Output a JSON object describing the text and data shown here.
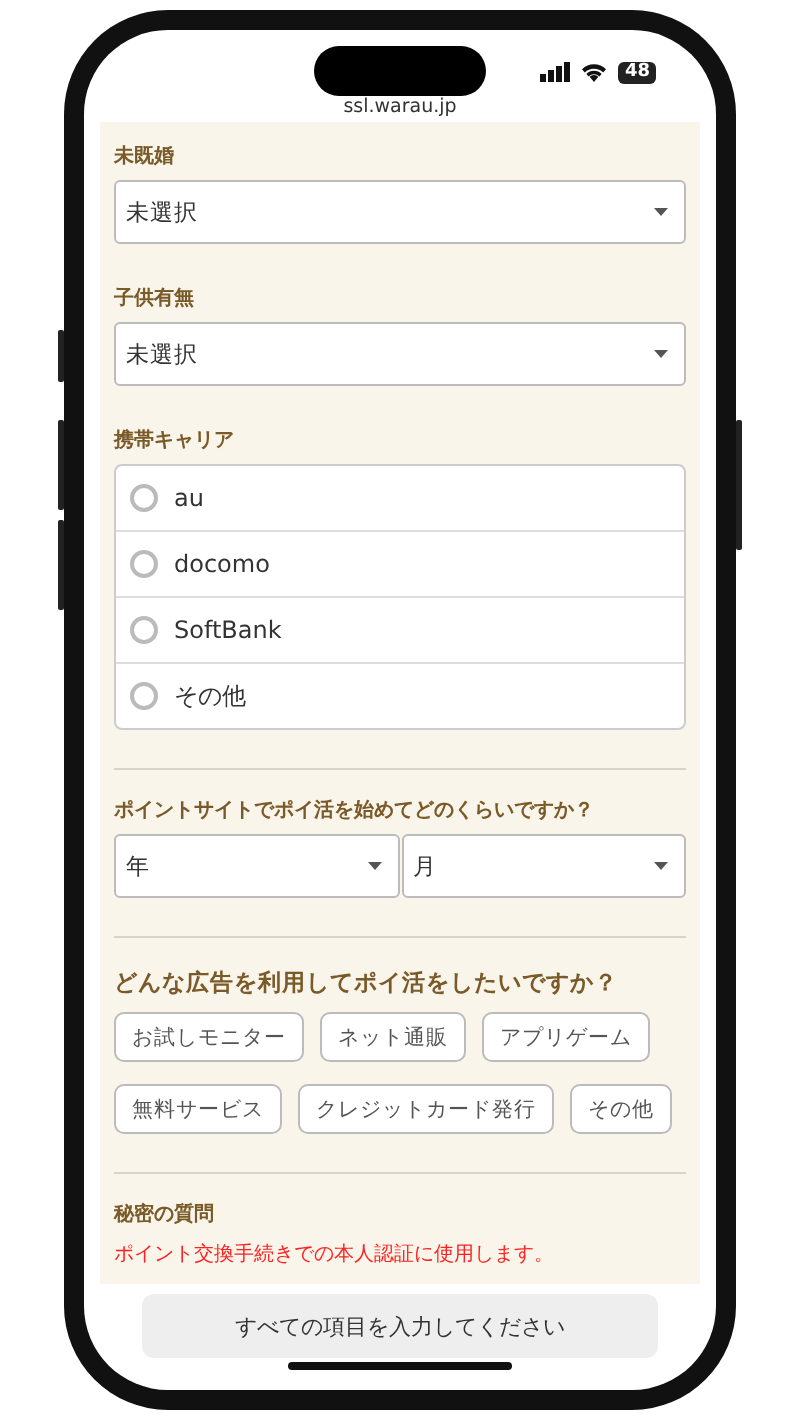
{
  "status_bar": {
    "battery": "48"
  },
  "address_bar": {
    "url": "ssl.warau.jp"
  },
  "fields": [
    {
      "label": "未既婚",
      "value": "未選択"
    },
    {
      "label": "子供有無",
      "value": "未選択"
    }
  ],
  "carrier": {
    "label": "携帯キャリア",
    "options": [
      {
        "label": "au",
        "selected": false
      },
      {
        "label": "docomo",
        "selected": false
      },
      {
        "label": "SoftBank",
        "selected": false
      },
      {
        "label": "その他",
        "selected": false
      }
    ]
  },
  "start_question": {
    "label": "ポイントサイトでポイ活を始めてどのくらいですか？",
    "selects": [
      {
        "value": "年"
      },
      {
        "value": "月"
      }
    ]
  },
  "ad_question": {
    "label": "どんな広告を利用してポイ活をしたいですか？",
    "chips": [
      {
        "label": "お試しモニター",
        "selected": false
      },
      {
        "label": "ネット通販",
        "selected": false
      },
      {
        "label": "アプリゲーム",
        "selected": false
      },
      {
        "label": "無料サービス",
        "selected": false
      },
      {
        "label": "クレジットカード発行",
        "selected": false
      },
      {
        "label": "その他",
        "selected": false
      }
    ]
  },
  "secret_question": {
    "label": "秘密の質問",
    "note": "ポイント交換手続きでの本人認証に使用します。"
  },
  "submit_button": {
    "label": "すべての項目を入力してください"
  }
}
